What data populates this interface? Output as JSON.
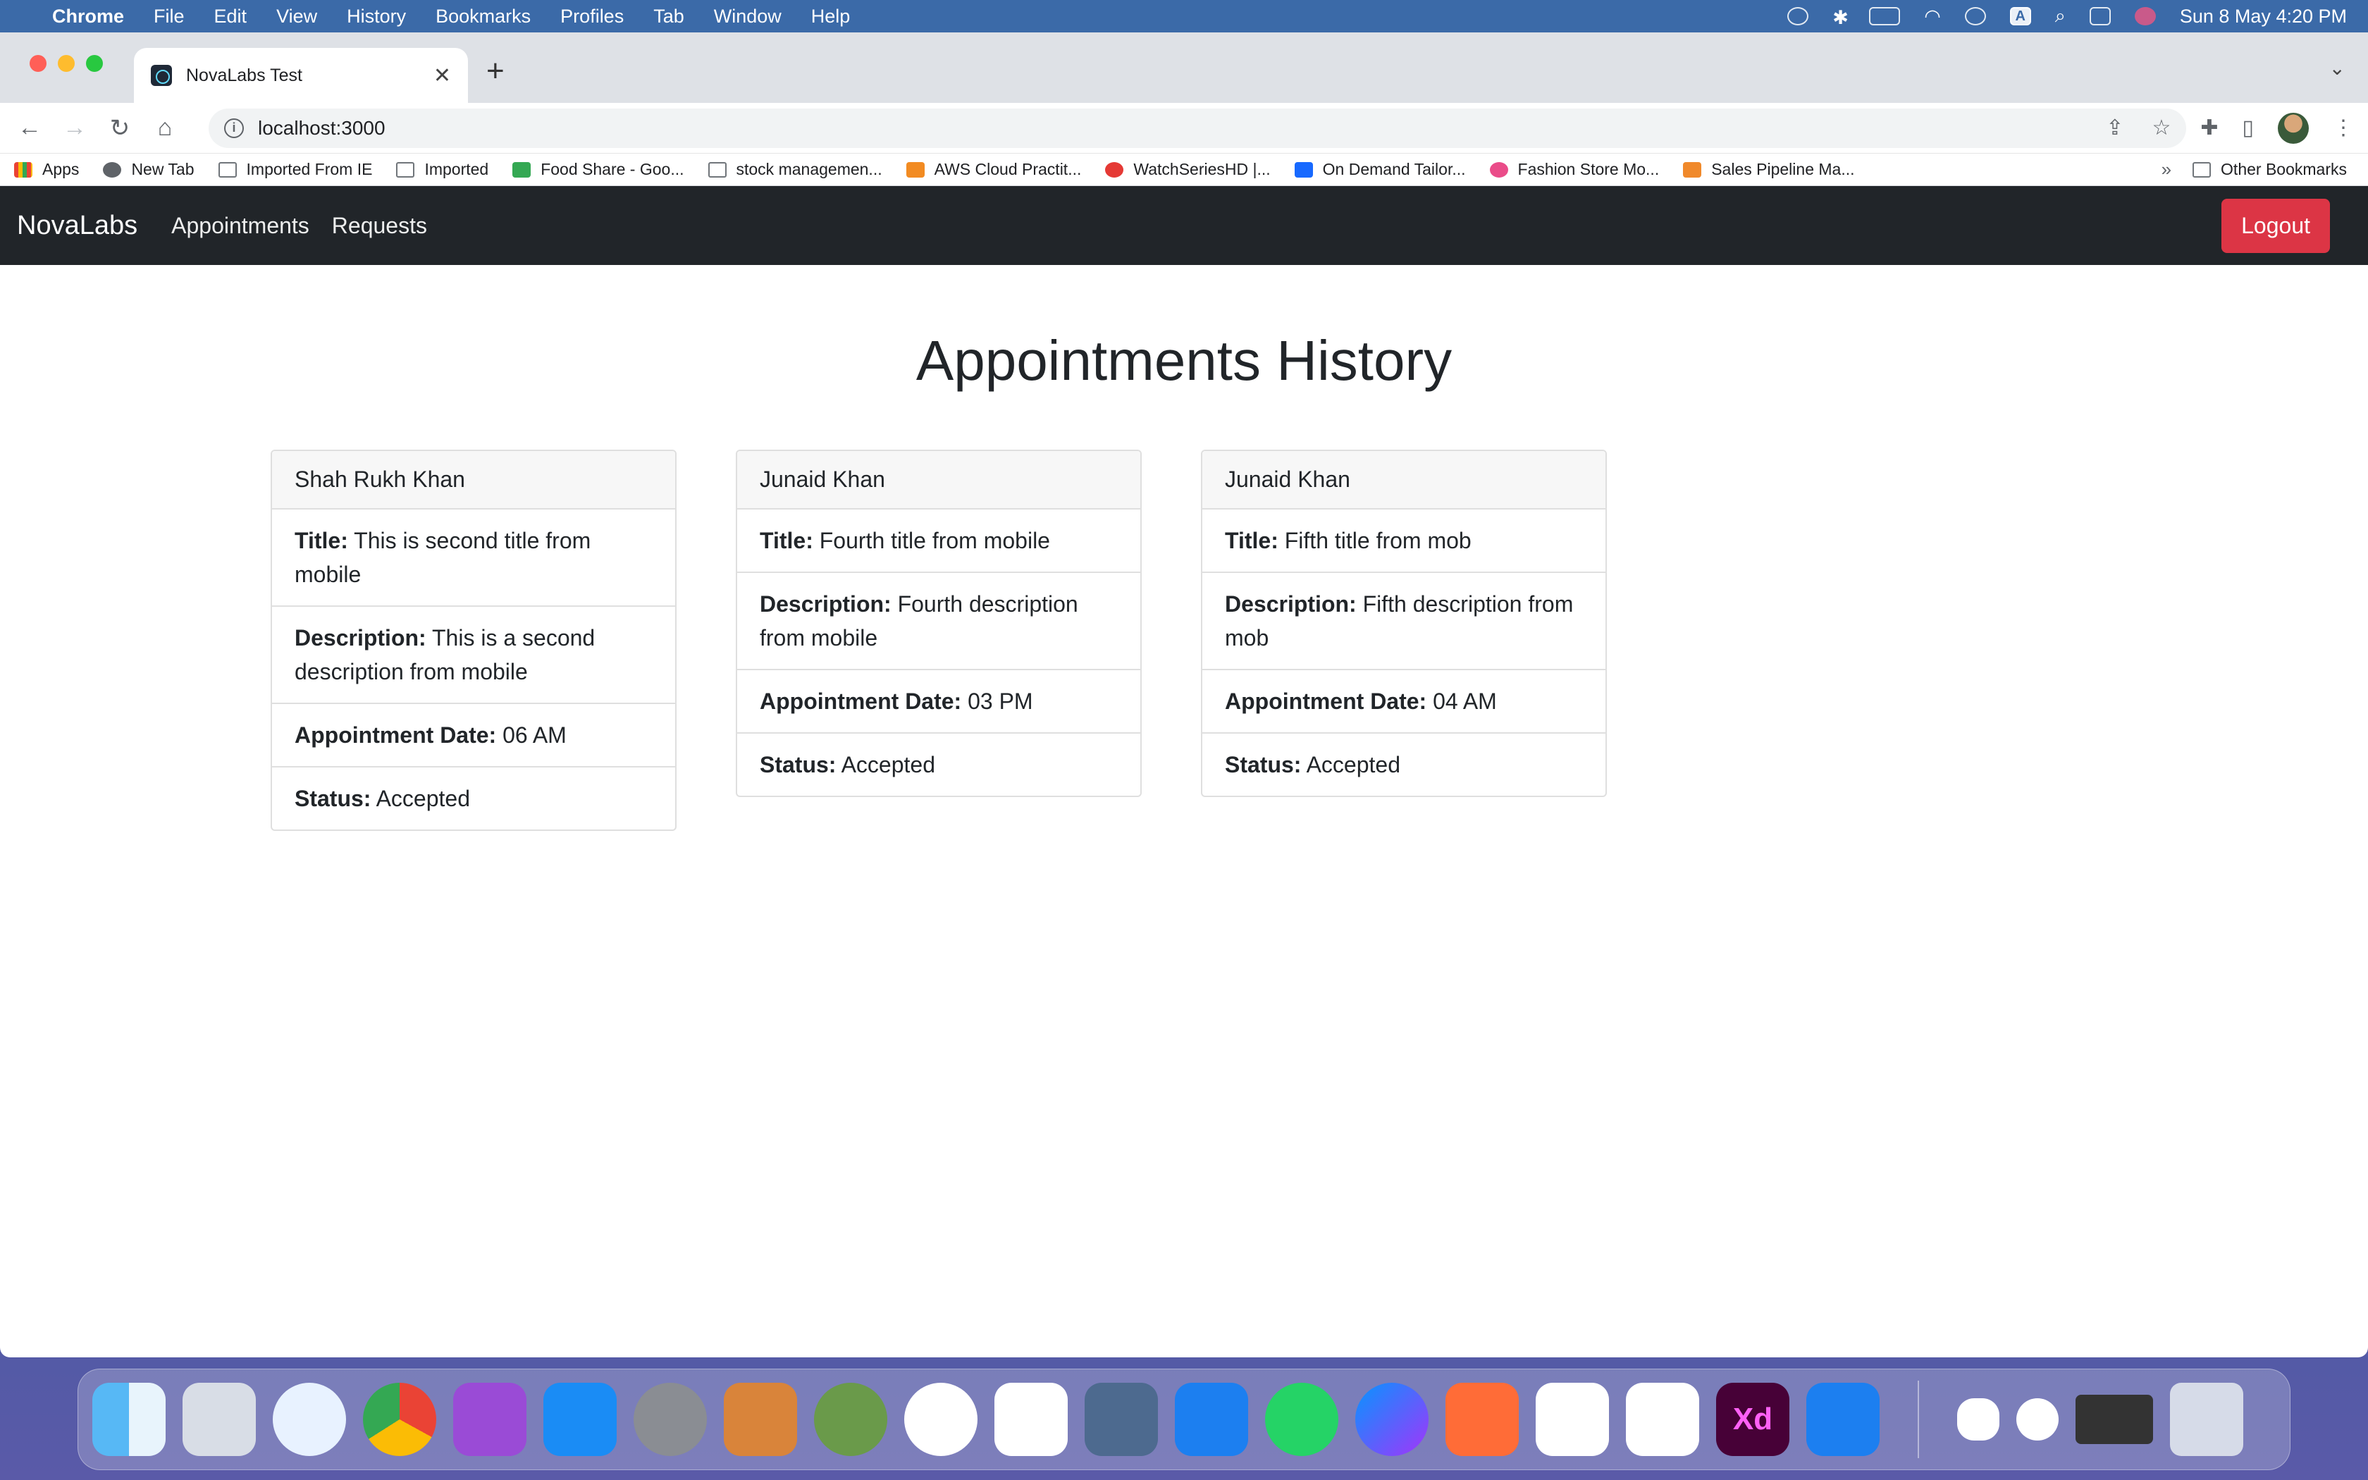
{
  "menubar": {
    "apple_icon": "apple-icon",
    "items": [
      "Chrome",
      "File",
      "Edit",
      "View",
      "History",
      "Bookmarks",
      "Profiles",
      "Tab",
      "Window",
      "Help"
    ],
    "clock": "Sun 8 May  4:20 PM",
    "status_letter": "A"
  },
  "browser": {
    "tab_title": "NovaLabs Test",
    "url": "localhost:3000",
    "new_tab_glyph": "+",
    "close_glyph": "✕"
  },
  "bookmarks": {
    "items": [
      {
        "label": "Apps",
        "icon": "apps-grid-icon"
      },
      {
        "label": "New Tab",
        "icon": "globe-icon"
      },
      {
        "label": "Imported From IE",
        "icon": "folder-icon"
      },
      {
        "label": "Imported",
        "icon": "folder-icon"
      },
      {
        "label": "Food Share - Goo...",
        "icon": "sheets-icon"
      },
      {
        "label": "stock managemen...",
        "icon": "folder-icon"
      },
      {
        "label": "AWS Cloud Practit...",
        "icon": "aws-icon"
      },
      {
        "label": "WatchSeriesHD |...",
        "icon": "play-icon"
      },
      {
        "label": "On Demand Tailor...",
        "icon": "behance-icon"
      },
      {
        "label": "Fashion Store Mo...",
        "icon": "dribbble-icon"
      },
      {
        "label": "Sales Pipeline Ma...",
        "icon": "app-icon"
      }
    ],
    "more": "»",
    "other": "Other Bookmarks"
  },
  "app": {
    "brand": "NovaLabs",
    "nav": [
      "Appointments",
      "Requests"
    ],
    "logout": "Logout",
    "page_title": "Appointments History",
    "labels": {
      "title": "Title:",
      "description": "Description:",
      "date": "Appointment Date:",
      "status": "Status:"
    },
    "cards": [
      {
        "name": "Shah Rukh Khan",
        "title": "This is second title from mobile",
        "description": "This is a second description from mobile",
        "date": "06 AM",
        "status": "Accepted"
      },
      {
        "name": "Junaid Khan",
        "title": "Fourth title from mobile",
        "description": "Fourth description from mobile",
        "date": "03 PM",
        "status": "Accepted"
      },
      {
        "name": "Junaid Khan",
        "title": "Fifth title from mob",
        "description": "Fifth description from mob",
        "date": "04 AM",
        "status": "Accepted"
      }
    ]
  },
  "dock": {
    "xd_label": "Xd"
  }
}
